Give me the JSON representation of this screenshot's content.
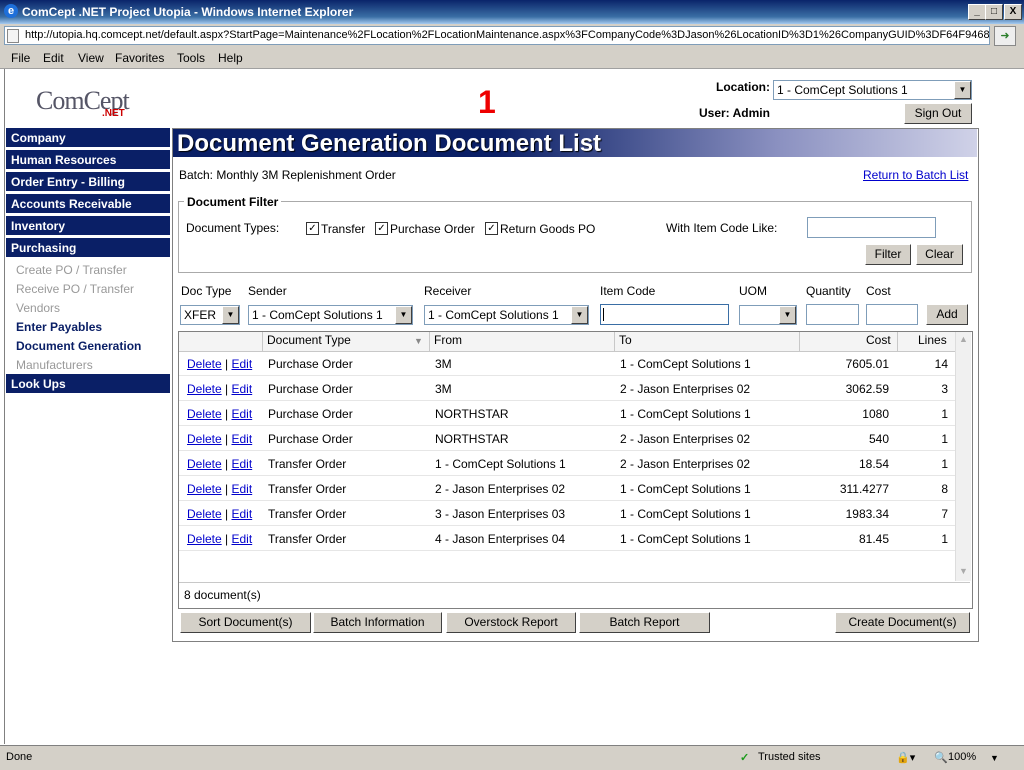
{
  "window": {
    "title": "ComCept .NET Project Utopia - Windows Internet Explorer",
    "min": "_",
    "max": "□",
    "close": "X"
  },
  "address": {
    "url": "http://utopia.hq.comcept.net/default.aspx?StartPage=Maintenance%2FLocation%2FLocationMaintenance.aspx%3FCompanyCode%3DJason%26LocationID%3D1%26CompanyGUID%3DF64F9468"
  },
  "menu": [
    "File",
    "Edit",
    "View",
    "Favorites",
    "Tools",
    "Help"
  ],
  "logo": {
    "main": "ComCept",
    "sub": ".NET"
  },
  "marker": "1",
  "location": {
    "label": "Location:",
    "value": "1 - ComCept Solutions 1"
  },
  "user": {
    "label": "User: Admin"
  },
  "sign_out": "Sign Out",
  "nav": {
    "company": "Company",
    "human_resources": "Human Resources",
    "order_entry": "Order Entry - Billing",
    "accounts_receivable": "Accounts Receivable",
    "inventory": "Inventory",
    "purchasing": "Purchasing",
    "sub": [
      "Create PO / Transfer",
      "Receive PO / Transfer",
      "Vendors",
      "Enter Payables",
      "Document Generation",
      "Manufacturers"
    ],
    "look_ups": "Look Ups"
  },
  "page": {
    "title": "Document Generation Document List",
    "batch": "Batch: Monthly 3M Replenishment Order",
    "return_link": "Return to Batch List"
  },
  "filter": {
    "legend": "Document Filter",
    "types_label": "Document Types:",
    "transfer": "Transfer",
    "purchase_order": "Purchase Order",
    "return_goods": "Return Goods PO",
    "check": "✓",
    "item_code_label": "With Item Code Like:",
    "filter_btn": "Filter",
    "clear_btn": "Clear"
  },
  "entry": {
    "doc_type_label": "Doc Type",
    "sender_label": "Sender",
    "receiver_label": "Receiver",
    "item_code_label": "Item Code",
    "uom_label": "UOM",
    "quantity_label": "Quantity",
    "cost_label": "Cost",
    "doc_type_value": "XFER",
    "sender_value": "1 - ComCept Solutions 1",
    "receiver_value": "1 - ComCept Solutions 1",
    "add_btn": "Add"
  },
  "grid": {
    "headers": {
      "doc_type": "Document Type",
      "from": "From",
      "to": "To",
      "cost": "Cost",
      "lines": "Lines"
    },
    "delete": "Delete",
    "sep": "|",
    "edit": "Edit",
    "rows": [
      {
        "type": "Purchase Order",
        "from": "3M",
        "to": "1 - ComCept Solutions 1",
        "cost": "7605.01",
        "lines": "14"
      },
      {
        "type": "Purchase Order",
        "from": "3M",
        "to": "2 - Jason Enterprises 02",
        "cost": "3062.59",
        "lines": "3"
      },
      {
        "type": "Purchase Order",
        "from": "NORTHSTAR",
        "to": "1 - ComCept Solutions 1",
        "cost": "1080",
        "lines": "1"
      },
      {
        "type": "Purchase Order",
        "from": "NORTHSTAR",
        "to": "2 - Jason Enterprises 02",
        "cost": "540",
        "lines": "1"
      },
      {
        "type": "Transfer Order",
        "from": "1 - ComCept Solutions 1",
        "to": "2 - Jason Enterprises 02",
        "cost": "18.54",
        "lines": "1"
      },
      {
        "type": "Transfer Order",
        "from": "2 - Jason Enterprises 02",
        "to": "1 - ComCept Solutions 1",
        "cost": "311.4277",
        "lines": "8"
      },
      {
        "type": "Transfer Order",
        "from": "3 - Jason Enterprises 03",
        "to": "1 - ComCept Solutions 1",
        "cost": "1983.34",
        "lines": "7"
      },
      {
        "type": "Transfer Order",
        "from": "4 - Jason Enterprises 04",
        "to": "1 - ComCept Solutions 1",
        "cost": "81.45",
        "lines": "1"
      }
    ],
    "count": "8 document(s)"
  },
  "buttons": {
    "sort": "Sort Document(s)",
    "batch_info": "Batch Information",
    "overstock": "Overstock Report",
    "batch_report": "Batch Report",
    "create": "Create Document(s)"
  },
  "status": {
    "left": "Done",
    "zone": "Trusted sites",
    "zoom": "100%"
  }
}
